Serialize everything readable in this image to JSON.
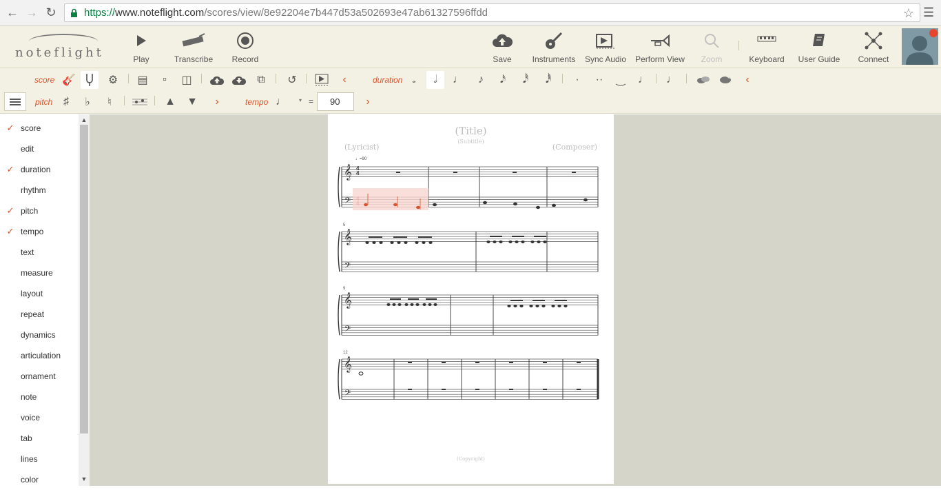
{
  "browser": {
    "url_scheme": "https://",
    "url_host": "www.noteflight.com",
    "url_path": "/scores/view/8e92204e7b447d53a502693e47ab61327596ffdd"
  },
  "app": {
    "logo": "noteflight",
    "header_buttons": {
      "play": "Play",
      "transcribe": "Transcribe",
      "record": "Record",
      "save": "Save",
      "instruments": "Instruments",
      "sync_audio": "Sync Audio",
      "perform_view": "Perform View",
      "zoom": "Zoom",
      "keyboard": "Keyboard",
      "user_guide": "User Guide",
      "connect": "Connect"
    }
  },
  "toolbar": {
    "score_label": "score",
    "duration_label": "duration",
    "pitch_label": "pitch",
    "tempo_label": "tempo",
    "tempo_value": "90",
    "tempo_equals": "="
  },
  "side": {
    "items": [
      {
        "label": "score",
        "checked": "✓"
      },
      {
        "label": "edit",
        "checked": ""
      },
      {
        "label": "duration",
        "checked": "✓"
      },
      {
        "label": "rhythm",
        "checked": ""
      },
      {
        "label": "pitch",
        "checked": "✓"
      },
      {
        "label": "tempo",
        "checked": "✓"
      },
      {
        "label": "text",
        "checked": ""
      },
      {
        "label": "measure",
        "checked": ""
      },
      {
        "label": "layout",
        "checked": ""
      },
      {
        "label": "repeat",
        "checked": ""
      },
      {
        "label": "dynamics",
        "checked": ""
      },
      {
        "label": "articulation",
        "checked": ""
      },
      {
        "label": "ornament",
        "checked": ""
      },
      {
        "label": "note",
        "checked": ""
      },
      {
        "label": "voice",
        "checked": ""
      },
      {
        "label": "tab",
        "checked": ""
      },
      {
        "label": "lines",
        "checked": ""
      },
      {
        "label": "color",
        "checked": ""
      }
    ]
  },
  "score": {
    "title": "(Title)",
    "subtitle": "(Subtitle)",
    "lyricist": "(Lyricist)",
    "composer": "(Composer)",
    "copyright": "(Copyright)",
    "tempo_mark": "♩=90",
    "measure_numbers": [
      "5",
      "9",
      "12"
    ]
  },
  "colors": {
    "accent": "#d9532c",
    "header_bg": "#f3f1e3",
    "workspace_bg": "#d5d5c9"
  }
}
